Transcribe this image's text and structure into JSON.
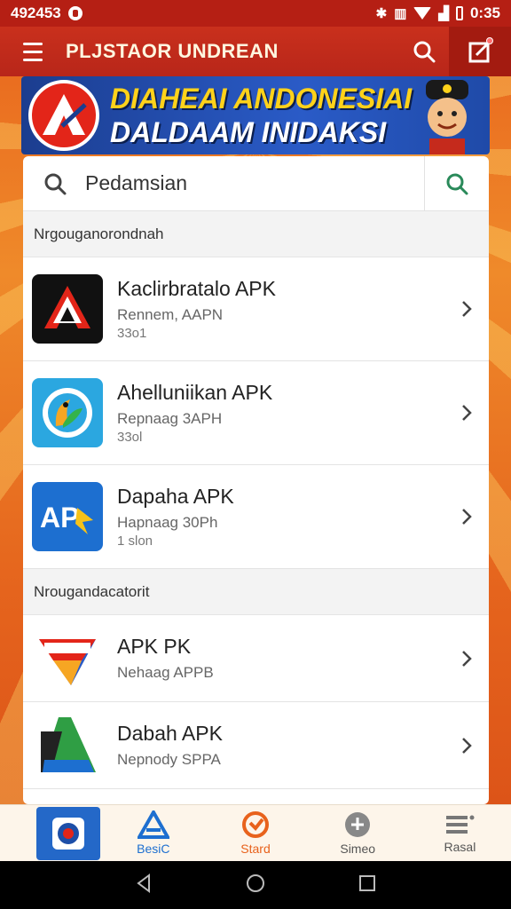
{
  "status_bar": {
    "time": "492453",
    "clock": "0:35"
  },
  "app_bar": {
    "title": "PLJSTAOR UNDREAN"
  },
  "banner": {
    "line1": "DIAHEAI ANDONESIAI",
    "line2": "DALDAAM INIDAKSI"
  },
  "search": {
    "value": "Pedamsian",
    "placeholder": "Pedamsian"
  },
  "sections": [
    {
      "header": "Nrgouganorondnah",
      "items": [
        {
          "name": "Kaclirbratalo APK",
          "sub": "Rennem, AAPN",
          "count": "33o1",
          "icon": "red-triangle-logo-icon"
        },
        {
          "name": "Ahelluniikan APK",
          "sub": "Repnaag 3APH",
          "count": "33ol",
          "icon": "parrot-app-icon"
        },
        {
          "name": "Dapaha APK",
          "sub": "Hapnaag 30Ph",
          "count": "1 slon",
          "icon": "apk-blue-icon"
        }
      ]
    },
    {
      "header": "Nrougandacatorit",
      "items": [
        {
          "name": "APK PK",
          "sub": "Nehaag APPB",
          "count": "",
          "icon": "flag-banner-icon"
        },
        {
          "name": "Dabah APK",
          "sub": "Nepnody SPPA",
          "count": "",
          "icon": "green-triangle-icon"
        }
      ]
    }
  ],
  "bottom_nav": [
    {
      "label": "",
      "icon": "home-app-icon"
    },
    {
      "label": "BesiC",
      "icon": "blue-triangle-icon"
    },
    {
      "label": "Stard",
      "icon": "orange-clock-icon"
    },
    {
      "label": "Simeo",
      "icon": "gray-download-icon"
    },
    {
      "label": "Rasal",
      "icon": "stack-menu-icon"
    }
  ],
  "colors": {
    "app_bar": "#c9301c",
    "status_bar": "#b51f14",
    "background": "#e8621c",
    "banner": "#2a5bc7"
  }
}
